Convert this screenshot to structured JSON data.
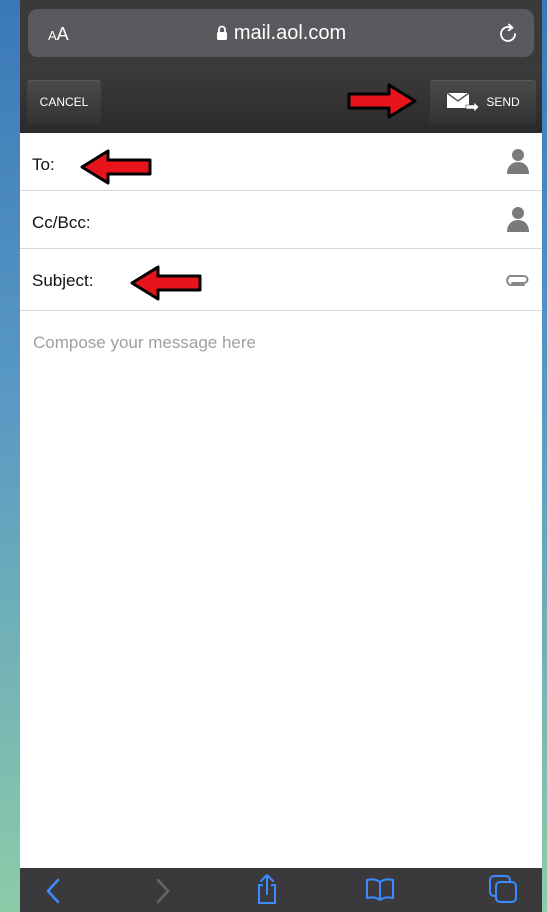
{
  "browser": {
    "aa_small": "A",
    "aa_large": "A",
    "url": "mail.aol.com"
  },
  "toolbar": {
    "cancel_label": "CANCEL",
    "send_label": "SEND"
  },
  "fields": {
    "to_label": "To:",
    "cc_label": "Cc/Bcc:",
    "subject_label": "Subject:"
  },
  "compose": {
    "placeholder": "Compose your message here"
  },
  "annotations": {
    "arrow_color": "#e8141c"
  },
  "icons": {
    "back": "chevron-left-icon",
    "forward": "chevron-right-icon",
    "share": "share-icon",
    "bookmarks": "book-icon",
    "tabs": "tabs-icon",
    "contact": "person-icon",
    "attach": "paperclip-icon"
  }
}
